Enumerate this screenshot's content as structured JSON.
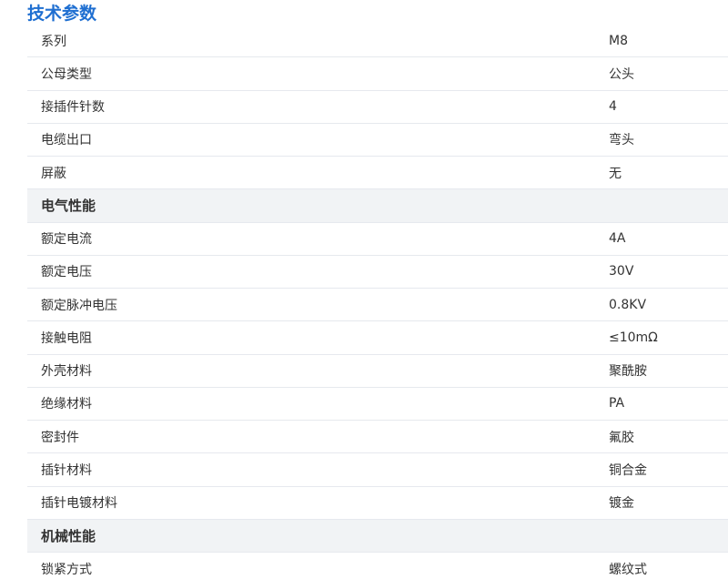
{
  "title": "技术参数",
  "rows": [
    {
      "label": "系列",
      "value": "M8"
    },
    {
      "label": "公母类型",
      "value": "公头"
    },
    {
      "label": "接插件针数",
      "value": "4"
    },
    {
      "label": "电缆出口",
      "value": "弯头"
    },
    {
      "label": "屏蔽",
      "value": "无"
    },
    {
      "section": "电气性能"
    },
    {
      "label": "额定电流",
      "value": "4A"
    },
    {
      "label": "额定电压",
      "value": "30V"
    },
    {
      "label": "额定脉冲电压",
      "value": "0.8KV"
    },
    {
      "label": "接触电阻",
      "value": "≤10mΩ"
    },
    {
      "label": "外壳材料",
      "value": "聚酰胺"
    },
    {
      "label": "绝缘材料",
      "value": "PA"
    },
    {
      "label": "密封件",
      "value": "氟胶"
    },
    {
      "label": "插针材料",
      "value": "铜合金"
    },
    {
      "label": "插针电镀材料",
      "value": "镀金"
    },
    {
      "section": "机械性能"
    },
    {
      "label": "锁紧方式",
      "value": "螺纹式"
    }
  ]
}
